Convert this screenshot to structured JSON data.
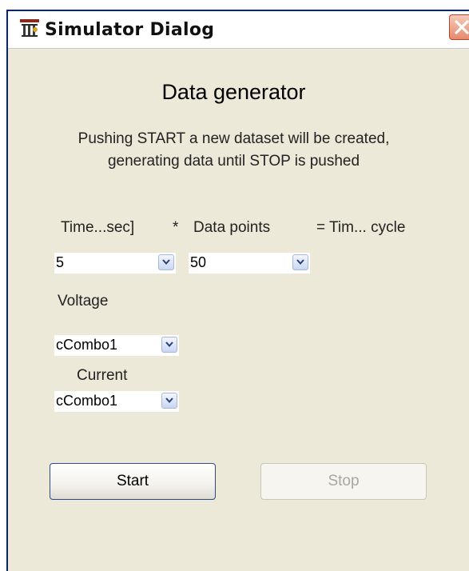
{
  "window": {
    "title": "Simulator Dialog",
    "icon": "simulator-app-icon",
    "close_icon": "close-icon",
    "accent": "#0a246a",
    "close_color": "#e58a6c"
  },
  "content": {
    "heading": "Data generator",
    "description_line1": "Pushing START a new dataset will be created,",
    "description_line2": "generating data until STOP is pushed"
  },
  "formula": {
    "time_label": "Time...sec]",
    "multiply": "*",
    "points_label": "Data points",
    "equals": "= Tim... cycle"
  },
  "combos": {
    "time_value": "5",
    "points_value": "50",
    "voltage_label": "Voltage",
    "voltage_value": "cCombo1",
    "current_label": "Current",
    "current_value": "cCombo1"
  },
  "buttons": {
    "start_label": "Start",
    "stop_label": "Stop",
    "stop_enabled": false
  }
}
